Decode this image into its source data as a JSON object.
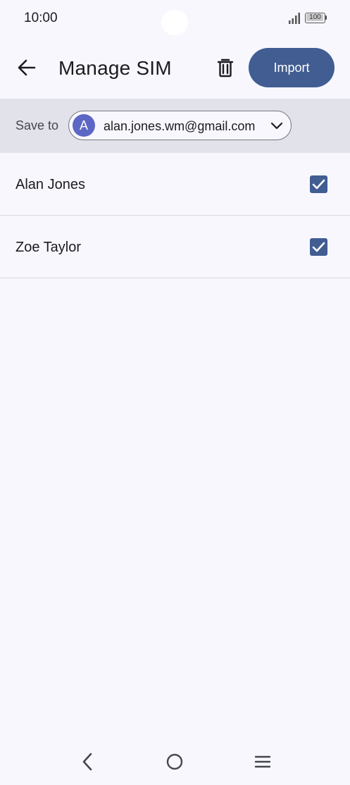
{
  "status_bar": {
    "time": "10:00",
    "battery": "100",
    "signal_icon": "signal-bars-icon",
    "battery_icon": "battery-icon"
  },
  "app_bar": {
    "back_icon": "arrow-back-icon",
    "title": "Manage SIM",
    "delete_icon": "trash-icon",
    "import_label": "Import"
  },
  "save_to": {
    "label": "Save to",
    "account": {
      "avatar_letter": "A",
      "email": "alan.jones.wm@gmail.com",
      "dropdown_icon": "chevron-down-icon"
    }
  },
  "contacts": [
    {
      "name": "Alan Jones",
      "checked": true
    },
    {
      "name": "Zoe Taylor",
      "checked": true
    }
  ],
  "nav_bar": {
    "back_icon": "nav-back-icon",
    "home_icon": "nav-home-icon",
    "recents_icon": "nav-recents-icon"
  },
  "colors": {
    "background": "#f8f7fd",
    "accent": "#415d92",
    "save_to_bar": "#e2e2ea",
    "avatar": "#5c67c5"
  }
}
